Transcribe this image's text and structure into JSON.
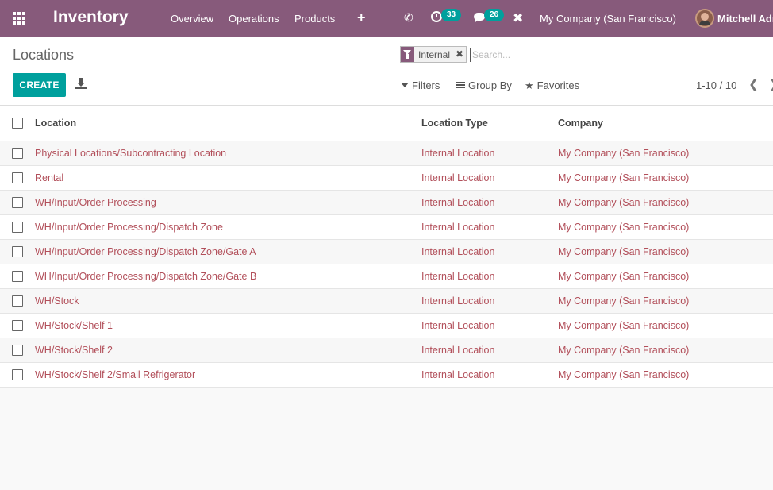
{
  "navbar": {
    "app_name": "Inventory",
    "menu": [
      "Overview",
      "Operations",
      "Products"
    ],
    "plus": "+",
    "activity_count": "33",
    "message_count": "26",
    "company": "My Company (San Francisco)",
    "user": "Mitchell Adr",
    "bg_color": "#875a7b"
  },
  "control": {
    "title": "Locations",
    "create_label": "CREATE",
    "facet_label": "Internal",
    "search_placeholder": "Search...",
    "filters_label": "Filters",
    "groupby_label": "Group By",
    "favorites_label": "Favorites",
    "pager": "1-10 / 10",
    "accent_color": "#00a09d"
  },
  "table": {
    "columns": [
      "Location",
      "Location Type",
      "Company"
    ],
    "rows": [
      [
        "Physical Locations/Subcontracting Location",
        "Internal Location",
        "My Company (San Francisco)"
      ],
      [
        "Rental",
        "Internal Location",
        "My Company (San Francisco)"
      ],
      [
        "WH/Input/Order Processing",
        "Internal Location",
        "My Company (San Francisco)"
      ],
      [
        "WH/Input/Order Processing/Dispatch Zone",
        "Internal Location",
        "My Company (San Francisco)"
      ],
      [
        "WH/Input/Order Processing/Dispatch Zone/Gate A",
        "Internal Location",
        "My Company (San Francisco)"
      ],
      [
        "WH/Input/Order Processing/Dispatch Zone/Gate B",
        "Internal Location",
        "My Company (San Francisco)"
      ],
      [
        "WH/Stock",
        "Internal Location",
        "My Company (San Francisco)"
      ],
      [
        "WH/Stock/Shelf 1",
        "Internal Location",
        "My Company (San Francisco)"
      ],
      [
        "WH/Stock/Shelf 2",
        "Internal Location",
        "My Company (San Francisco)"
      ],
      [
        "WH/Stock/Shelf 2/Small Refrigerator",
        "Internal Location",
        "My Company (San Francisco)"
      ]
    ]
  }
}
